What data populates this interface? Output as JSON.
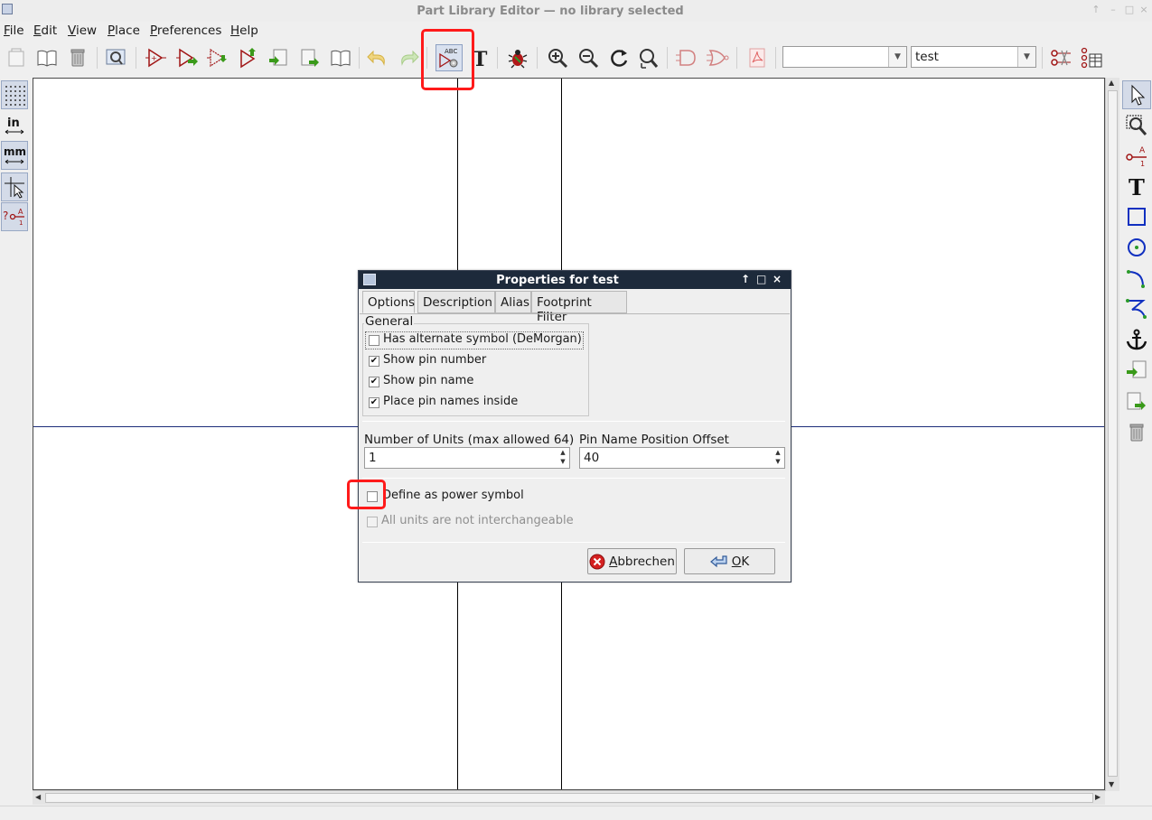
{
  "window": {
    "title": "Part Library Editor — no library selected",
    "controls": [
      "↑",
      "–",
      "□",
      "×"
    ]
  },
  "menubar": {
    "items": [
      {
        "label": "File",
        "u": "F",
        "rest": "ile"
      },
      {
        "label": "Edit",
        "u": "E",
        "rest": "dit"
      },
      {
        "label": "View",
        "u": "V",
        "rest": "iew"
      },
      {
        "label": "Place",
        "u": "P",
        "rest": "lace"
      },
      {
        "label": "Preferences",
        "u": "P",
        "rest": "references"
      },
      {
        "label": "Help",
        "u": "H",
        "rest": "elp"
      }
    ]
  },
  "toolbar": {
    "library_select": "",
    "part_select": "test",
    "edit_properties_icon_text": "ABC",
    "text_tool_glyph": "T"
  },
  "left_toolbar": {
    "units_in": "in",
    "units_mm": "mm"
  },
  "right_toolbar": {
    "text_glyph": "T",
    "pin_sublabel_top": "A",
    "pin_sublabel_bottom": "1"
  },
  "dialog": {
    "title": "Properties for test",
    "title_controls": [
      "↑",
      "□",
      "×"
    ],
    "tabs": [
      {
        "label": "Options",
        "active": true
      },
      {
        "label": "Description",
        "active": false
      },
      {
        "label": "Alias",
        "active": false
      },
      {
        "label": "Footprint Filter",
        "active": false
      }
    ],
    "general_group": "General",
    "checkboxes": [
      {
        "label": "Has alternate symbol (DeMorgan)",
        "checked": false
      },
      {
        "label": "Show pin number",
        "checked": true
      },
      {
        "label": "Show pin name",
        "checked": true
      },
      {
        "label": "Place pin names inside",
        "checked": true
      }
    ],
    "units_label": "Number of Units (max allowed 64)",
    "units_value": "1",
    "offset_label": "Pin Name Position Offset",
    "offset_value": "40",
    "power_label": "Define as power symbol",
    "power_checked": false,
    "interchange_label": "All units are not interchangeable",
    "interchange_checked": false,
    "cancel_label": "Abbrechen",
    "cancel_u": "A",
    "cancel_rest": "bbrechen",
    "ok_label": "OK",
    "ok_u": "O",
    "ok_rest": "K"
  },
  "colors": {
    "highlight": "#ff1a1a",
    "axis_line": "#1c2d7a",
    "dialog_titlebar": "#1d2a3b"
  }
}
